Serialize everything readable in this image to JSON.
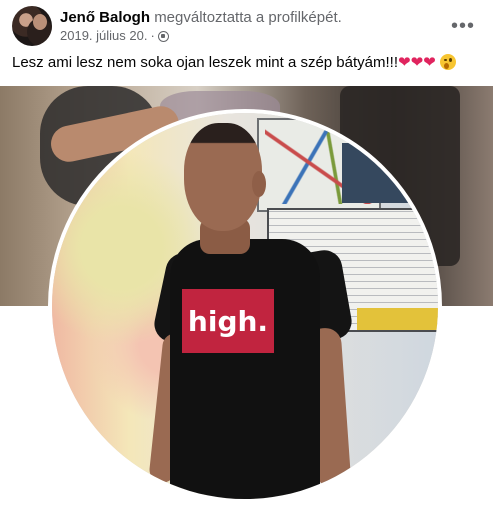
{
  "post": {
    "author": "Jenő Balogh",
    "action": "megváltoztatta a profilképét.",
    "date": "2019. július 20.",
    "separator": "·",
    "privacy_icon": "globe-icon",
    "more_label": "•••",
    "text": "Lesz ami lesz nem soka ojan leszek mint a szép bátyám!!!",
    "emojis": [
      "❤",
      "❤",
      "❤"
    ]
  },
  "photo": {
    "shirt_text": "high."
  },
  "colors": {
    "heart": "#e0245e",
    "secondary_text": "#65676b",
    "shirt_logo": "#c1243f"
  }
}
